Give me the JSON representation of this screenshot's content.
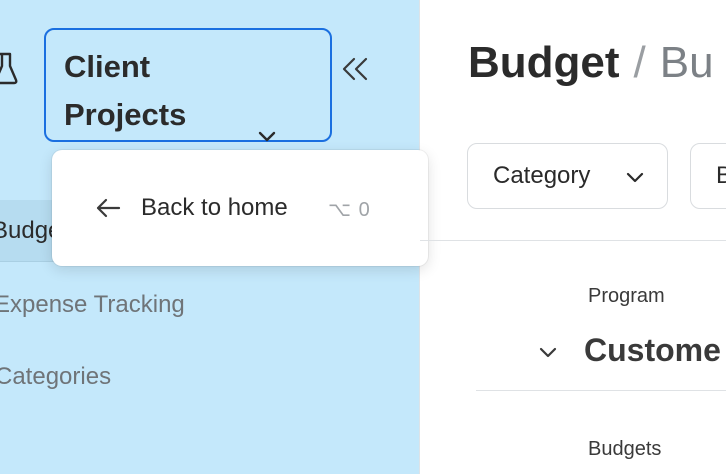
{
  "sidebar": {
    "workspace": {
      "label": "Client Projects"
    },
    "nav": [
      {
        "label": "Budget"
      },
      {
        "label": "Expense Tracking"
      },
      {
        "label": "Categories"
      }
    ]
  },
  "popover": {
    "back_label": "Back to home",
    "shortcut": "⌥ 0"
  },
  "main": {
    "breadcrumb": {
      "current": "Budget",
      "separator": "/",
      "next": "Bu"
    },
    "filters": [
      {
        "label": "Category"
      },
      {
        "label": "B"
      }
    ],
    "program_label": "Program",
    "program_value": "Custome",
    "budgets_label": "Budgets"
  },
  "colors": {
    "sidebar_bg": "#c4e8fb",
    "accent": "#1a6fe0"
  }
}
